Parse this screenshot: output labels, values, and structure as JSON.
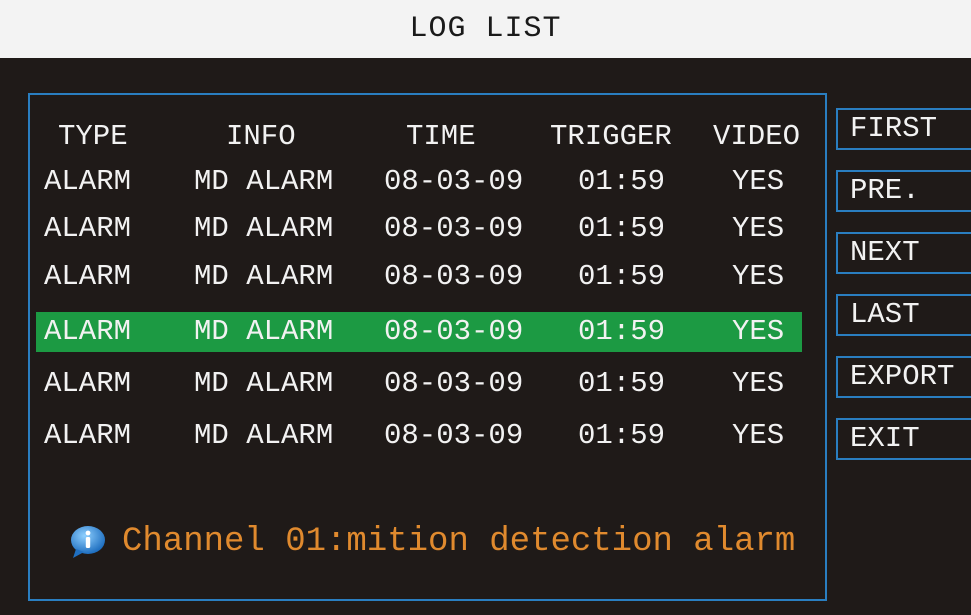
{
  "title": "LOG LIST",
  "columns": [
    "TYPE",
    "INFO",
    "TIME",
    "TRIGGER",
    "VIDEO"
  ],
  "rows": [
    {
      "type": "ALARM",
      "info": "MD ALARM",
      "time": "08-03-09",
      "trigger": "01:59",
      "video": "YES"
    },
    {
      "type": "ALARM",
      "info": "MD ALARM",
      "time": "08-03-09",
      "trigger": "01:59",
      "video": "YES"
    },
    {
      "type": "ALARM",
      "info": "MD ALARM",
      "time": "08-03-09",
      "trigger": "01:59",
      "video": "YES"
    },
    {
      "type": "ALARM",
      "info": "MD ALARM",
      "time": "08-03-09",
      "trigger": "01:59",
      "video": "YES"
    },
    {
      "type": "ALARM",
      "info": "MD ALARM",
      "time": "08-03-09",
      "trigger": "01:59",
      "video": "YES"
    },
    {
      "type": "ALARM",
      "info": "MD ALARM",
      "time": "08-03-09",
      "trigger": "01:59",
      "video": "YES"
    }
  ],
  "selected_row": 3,
  "status_message": "Channel 01:mition detection alarm",
  "status_icon": "info-icon",
  "buttons": {
    "first": "FIRST",
    "pre": "PRE.",
    "next": "NEXT",
    "last": "LAST",
    "export": "EXPORT",
    "exit": "EXIT"
  },
  "colors": {
    "background": "#1f1a18",
    "title_bar": "#f3f3f3",
    "border": "#2a7ec0",
    "selected_row": "#1c9a43",
    "status_text": "#e08a2e"
  }
}
